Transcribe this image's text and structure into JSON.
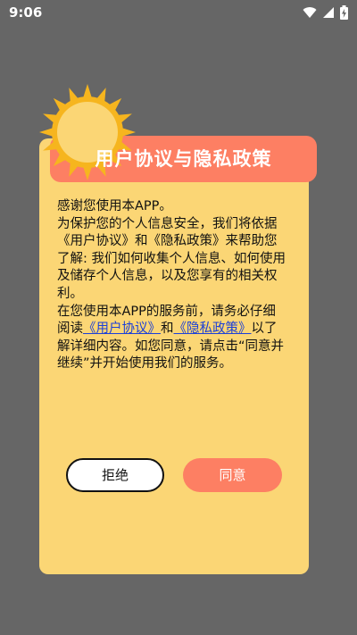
{
  "status_bar": {
    "time": "9:06",
    "icons": [
      "wifi-icon",
      "signal-icon",
      "battery-charging-icon"
    ]
  },
  "dialog": {
    "title": "用户协议与隐私政策",
    "para1": "感谢您使用本APP。",
    "para2": "为保护您的个人信息安全，我们将依据《用户协议》和《隐私政策》来帮助您了解: 我们如何收集个人信息、如何使用及储存个人信息，以及您享有的相关权利。",
    "para3_prefix": "在您使用本APP的服务前，请务必仔细阅读",
    "user_agreement_link": "《用户协议》",
    "and_text": "和",
    "privacy_policy_link": "《隐私政策》",
    "para3_suffix": "以了解详细内容。如您同意，请点击“同意并继续”并开始使用我们的服务。",
    "refuse_label": "拒绝",
    "agree_label": "同意"
  },
  "colors": {
    "background": "#666666",
    "dialog_bg": "#fbd675",
    "accent": "#fd7f63",
    "link": "#1b3fd8",
    "sun": "#f6b51e"
  }
}
